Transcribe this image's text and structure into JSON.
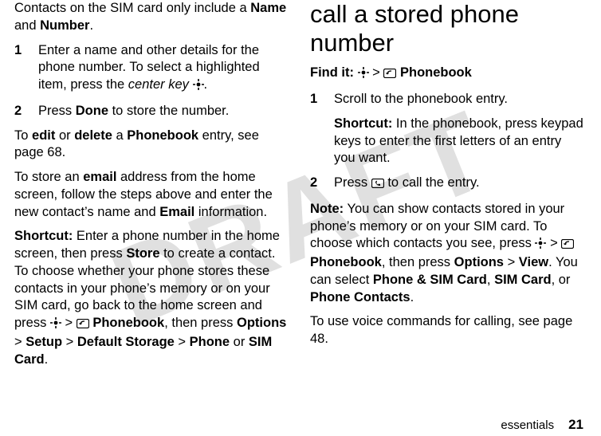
{
  "watermark": "DRAFT",
  "left": {
    "p1a": "Contacts on the SIM card only include a ",
    "p1_name": "Name",
    "p1b": " and ",
    "p1_number": "Number",
    "p1c": ".",
    "step1_num": "1",
    "step1a": "Enter a name and other details for the phone number. To select a highlighted item, press the ",
    "step1_ck": "center key",
    "step1b": " ",
    "step1c": ".",
    "step2_num": "2",
    "step2a": "Press ",
    "step2_done": "Done",
    "step2b": " to store the number.",
    "p2a": "To ",
    "p2_edit": "edit",
    "p2b": " or ",
    "p2_delete": "delete",
    "p2c": " a ",
    "p2_pb": "Phonebook",
    "p2d": " entry, see page 68.",
    "p3a": "To store an ",
    "p3_email": "email",
    "p3b": " address from the home screen, follow the steps above and enter the new contact’s name and ",
    "p3_emailcond": "Email",
    "p3c": " information.",
    "p4_short": "Shortcut:",
    "p4a": " Enter a phone number in the home screen, then press ",
    "p4_store": "Store",
    "p4b": " to create a contact. To choose whether your phone stores these contacts in your phone’s memory or on your SIM card, go back to the home screen and press ",
    "p4c": " > ",
    "p4_pb": "Phonebook",
    "p4d": ", then press ",
    "p4_opt": "Options",
    "p4e": " > ",
    "p4_setup": "Setup",
    "p4f": " > ",
    "p4_def": "Default Storage",
    "p4g": " > ",
    "p4_phone": "Phone",
    "p4h": " or ",
    "p4_sim": "SIM Card",
    "p4i": "."
  },
  "right": {
    "heading": "call a stored phone number",
    "find_lbl": "Find it:",
    "find_a": " ",
    "find_b": " > ",
    "find_pb": "Phonebook",
    "step1_num": "1",
    "step1": "Scroll to the phonebook entry.",
    "sc_lbl": "Shortcut:",
    "sc_txt": " In the phonebook, press keypad keys to enter the first letters of an entry you want.",
    "step2_num": "2",
    "step2a": "Press ",
    "step2b": " to call the entry.",
    "note_lbl": "Note:",
    "note_a": " You can show contacts stored in your phone’s memory or on your SIM card. To choose which contacts you see, press ",
    "note_b": " > ",
    "note_pb": "Phonebook",
    "note_c": ", then press ",
    "note_opt": "Options",
    "note_d": " > ",
    "note_view": "View",
    "note_e": ". You can select ",
    "note_ps": "Phone & SIM Card",
    "note_f": ", ",
    "note_sim": "SIM Card",
    "note_g": ", or ",
    "note_pc": "Phone Contacts",
    "note_h": ".",
    "vc": "To use voice commands for calling, see page 48."
  },
  "footer": {
    "label": "essentials",
    "page": "21"
  }
}
